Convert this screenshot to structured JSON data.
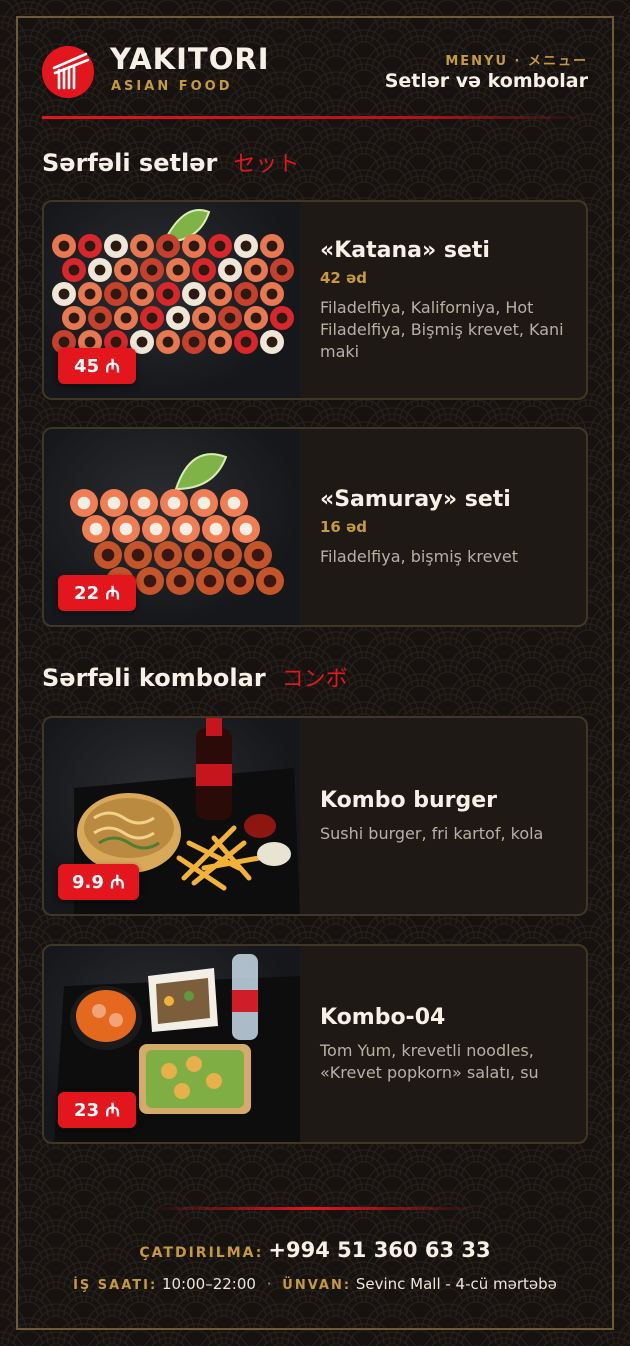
{
  "brand": {
    "name": "YAKITORI",
    "tagline": "ASIAN FOOD",
    "accent": "#e3161d",
    "gold": "#c79a3e"
  },
  "header": {
    "menu_label": "MENYU · メニュー",
    "menu_title": "Setlər və kombolar"
  },
  "sections": [
    {
      "title": "Sərfəli setlər",
      "title_jp": "セット",
      "items": [
        {
          "name": "«Katana» seti",
          "count": "42 əd",
          "description": "Filadelfiya, Kaliforniya, Hot Filadelfiya, Bişmiş krevet, Kani maki",
          "price": "45 ₼",
          "image_icon": "sushi-set-image"
        },
        {
          "name": "«Samuray» seti",
          "count": "16 əd",
          "description": "Filadelfiya, bişmiş krevet",
          "price": "22 ₼",
          "image_icon": "sushi-set-image"
        }
      ]
    },
    {
      "title": "Sərfəli kombolar",
      "title_jp": "コンボ",
      "items": [
        {
          "name": "Kombo burger",
          "description": "Sushi burger, fri kartof, kola",
          "price": "9.9 ₼",
          "image_icon": "burger-combo-image"
        },
        {
          "name": "Kombo-04",
          "description": "Tom Yum, krevetli noodles, «Krevet popkorn» salatı, su",
          "price": "23 ₼",
          "image_icon": "soup-combo-image"
        }
      ]
    }
  ],
  "footer": {
    "delivery_label": "ÇATDIRILMA:",
    "phone": "+994 51 360 63 33",
    "hours_label": "İŞ SAATI:",
    "hours": "10:00–22:00",
    "separator": "·",
    "address_label": "ÜNVAN:",
    "address": "Sevinc Mall - 4-cü mərtəbə"
  }
}
